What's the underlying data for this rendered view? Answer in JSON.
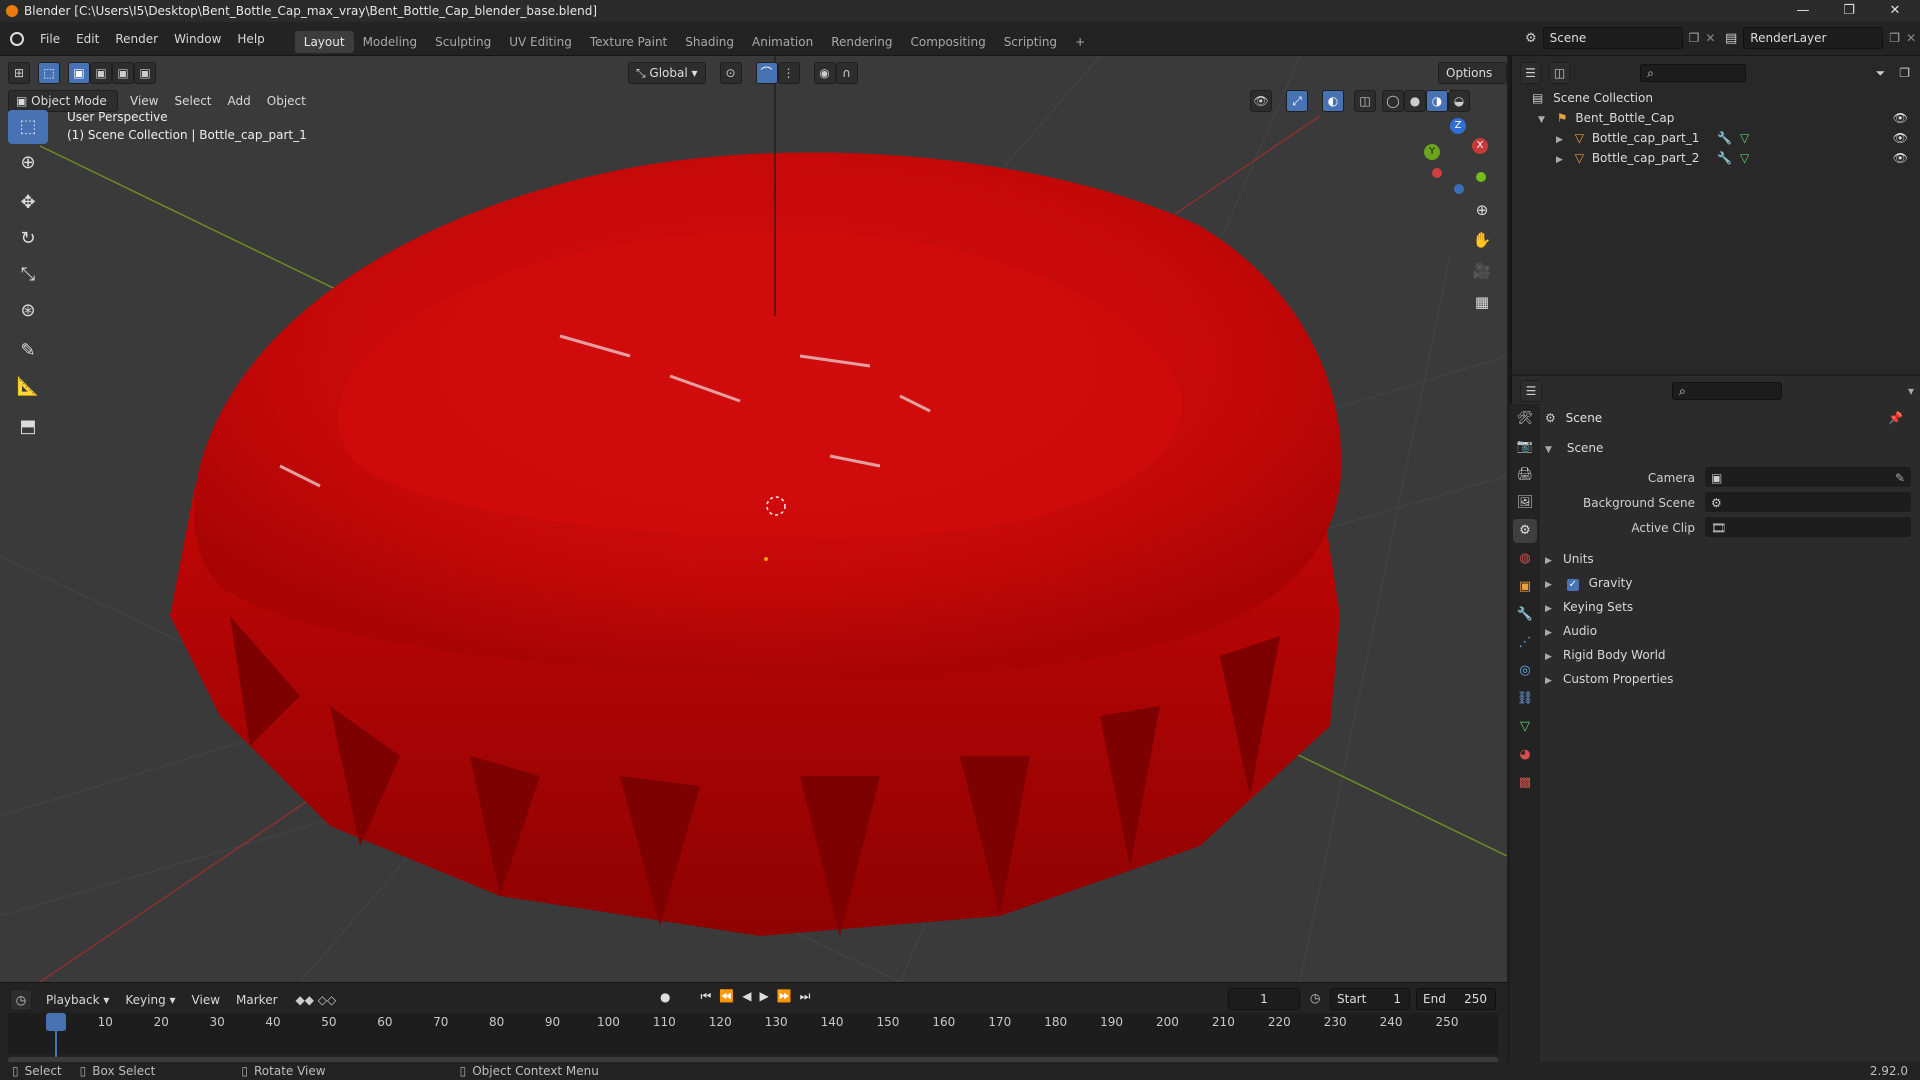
{
  "window": {
    "title": "Blender [C:\\Users\\I5\\Desktop\\Bent_Bottle_Cap_max_vray\\Bent_Bottle_Cap_blender_base.blend]",
    "minimize": "—",
    "maximize": "❐",
    "close": "✕"
  },
  "menu": [
    "File",
    "Edit",
    "Render",
    "Window",
    "Help"
  ],
  "workspaces": [
    "Layout",
    "Modeling",
    "Sculpting",
    "UV Editing",
    "Texture Paint",
    "Shading",
    "Animation",
    "Rendering",
    "Compositing",
    "Scripting"
  ],
  "workspace_add": "+",
  "scene_field": "Scene",
  "render_layer_field": "RenderLayer",
  "viewport": {
    "transform_orientation": "Global",
    "options_label": "Options",
    "mode_label": "Object Mode",
    "header_menus": [
      "View",
      "Select",
      "Add",
      "Object"
    ],
    "overlay_line1": "User Perspective",
    "overlay_line2": "(1) Scene Collection | Bottle_cap_part_1",
    "gizmo_axes": [
      "Z",
      "Y",
      "X"
    ],
    "object_color": "#cc0808"
  },
  "toolbar_icons": [
    "select-box",
    "cursor",
    "move",
    "rotate",
    "scale",
    "transform",
    "annotate",
    "measure",
    "add-cube"
  ],
  "outliner": {
    "root": "Scene Collection",
    "collection": "Bent_Bottle_Cap",
    "objects": [
      "Bottle_cap_part_1",
      "Bottle_cap_part_2"
    ]
  },
  "properties": {
    "context": "Scene",
    "panel_title": "Scene",
    "fields": [
      {
        "label": "Camera",
        "value": ""
      },
      {
        "label": "Background Scene",
        "value": ""
      },
      {
        "label": "Active Clip",
        "value": ""
      }
    ],
    "sections": [
      "Units",
      "Gravity",
      "Keying Sets",
      "Audio",
      "Rigid Body World",
      "Custom Properties"
    ],
    "gravity_checked": true
  },
  "timeline": {
    "menus": [
      "Playback",
      "Keying",
      "View",
      "Marker"
    ],
    "current_frame": "1",
    "start_label": "Start",
    "start_value": "1",
    "end_label": "End",
    "end_value": "250",
    "ticks": [
      "1",
      "10",
      "20",
      "30",
      "40",
      "50",
      "60",
      "70",
      "80",
      "90",
      "100",
      "110",
      "120",
      "130",
      "140",
      "150",
      "160",
      "170",
      "180",
      "190",
      "200",
      "210",
      "220",
      "230",
      "240",
      "250"
    ]
  },
  "statusbar": {
    "select": "Select",
    "box_select": "Box Select",
    "rotate_view": "Rotate View",
    "context_menu": "Object Context Menu",
    "version": "2.92.0"
  }
}
